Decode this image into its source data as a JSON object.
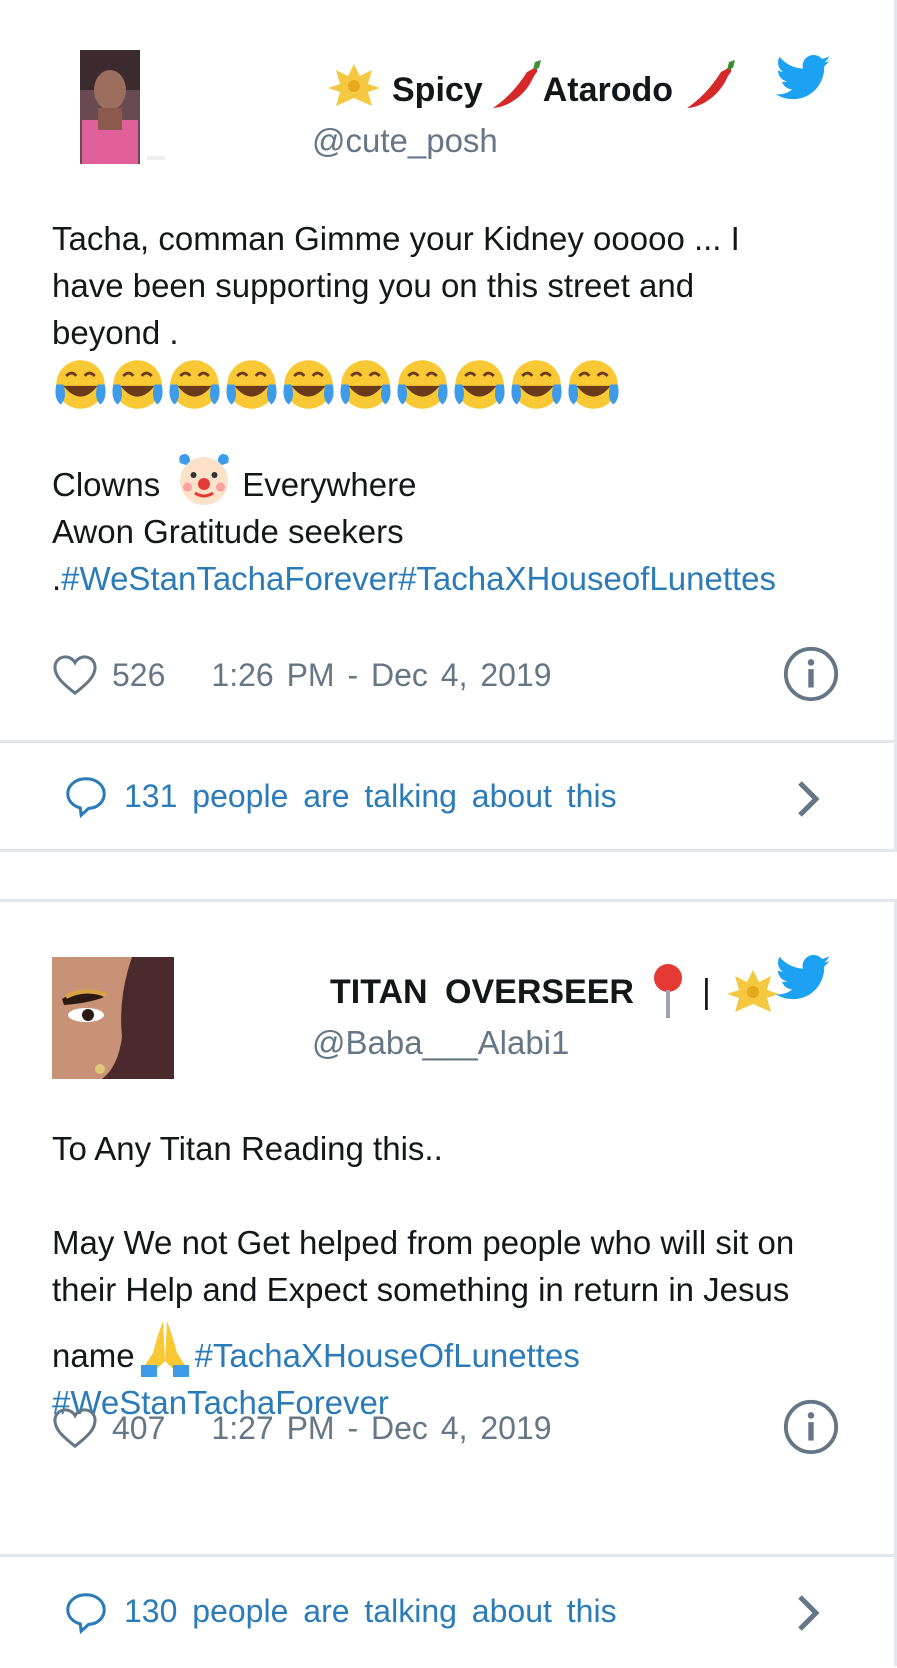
{
  "tweets": [
    {
      "display_name_part1": "Spicy",
      "display_name_part2": "Atarodo",
      "handle": "@cute_posh",
      "line1": "Tacha, comman Gimme your Kidney ooooo ... I",
      "line2": "have been supporting you on this street and",
      "line3": "beyond .",
      "clowns_before": "Clowns",
      "clowns_after": "Everywhere",
      "awon": "Awon Gratitude seekers",
      "dot": ".",
      "hashtag1": "#WeStanTachaForever",
      "hashtag2": "#TachaXHouseofLunettes",
      "likes": "526",
      "timestamp": "1:26 PM - Dec 4, 2019",
      "talking": "131 people are talking about this"
    },
    {
      "display_name": "TITAN OVERSEER",
      "separator": "|",
      "handle": "@Baba___Alabi1",
      "line1": "To Any Titan Reading this..",
      "line2": "May We not Get helped from people who will sit on",
      "line3": "their Help and Expect something in return in Jesus",
      "line4_prefix": "name",
      "hashtag1": "#TachaXHouseOfLunettes",
      "hashtag2": "#WeStanTachaForever",
      "likes": "407",
      "timestamp": "1:27 PM - Dec 4, 2019",
      "talking": "130 people are talking about this"
    }
  ],
  "colors": {
    "link": "#2b7bb9",
    "meta": "#657786",
    "twitter_blue": "#1da1f2",
    "border": "#e1e8ed"
  },
  "icons": [
    "heart-icon",
    "info-icon",
    "speech-bubble-icon",
    "chevron-right-icon",
    "twitter-bird-icon",
    "crown-emoji-icon",
    "chili-pepper-emoji-icon",
    "laughing-tears-emoji-icon",
    "clown-emoji-icon",
    "pushpin-emoji-icon",
    "praying-hands-emoji-icon"
  ]
}
